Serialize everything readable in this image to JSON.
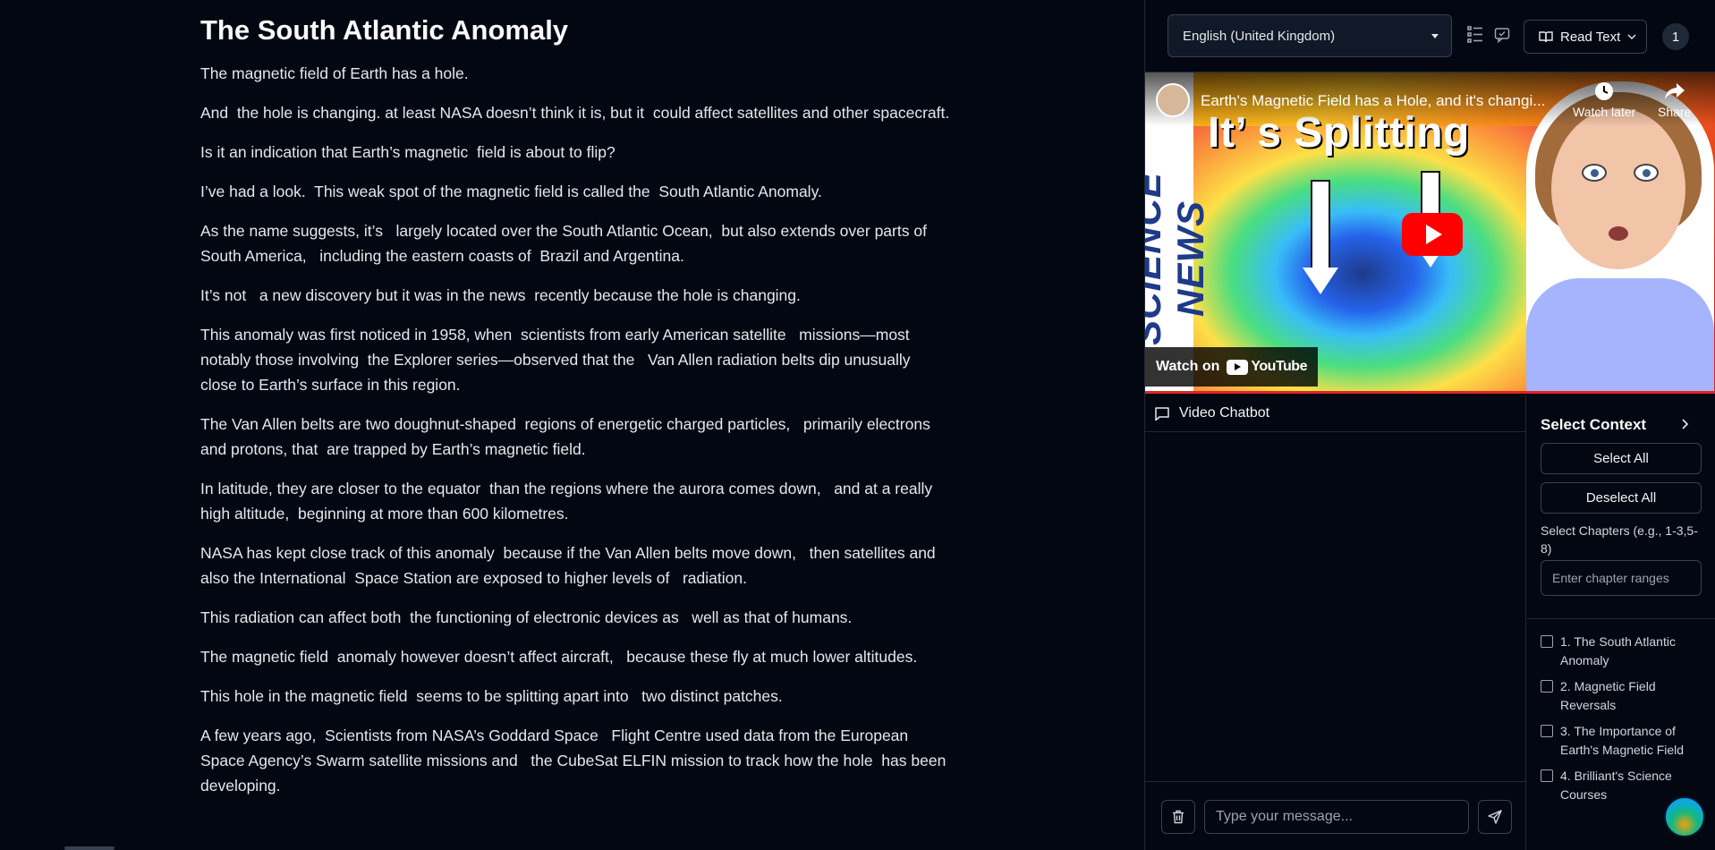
{
  "article": {
    "title": "The South Atlantic Anomaly",
    "paragraphs": [
      "The magnetic field of Earth has a hole.",
      "And  the hole is changing. at least NASA doesn’t think it is, but it  could affect satellites and other spacecraft.",
      "Is it an indication that Earth’s magnetic  field is about to flip?",
      "I’ve had a look.  This weak spot of the magnetic field is called the  South Atlantic Anomaly.",
      "As the name suggests, it’s   largely located over the South Atlantic Ocean,  but also extends over parts of South America,   including the eastern coasts of  Brazil and Argentina.",
      "It’s not   a new discovery but it was in the news  recently because the hole is changing.",
      "This anomaly was first noticed in 1958, when  scientists from early American satellite   missions—most notably those involving  the Explorer series—observed that the   Van Allen radiation belts dip unusually  close to Earth’s surface in this region.",
      "The Van Allen belts are two doughnut-shaped  regions of energetic charged particles,   primarily electrons and protons, that  are trapped by Earth’s magnetic field.",
      "In latitude, they are closer to the equator  than the regions where the aurora comes down,   and at a really high altitude,  beginning at more than 600 kilometres.",
      "NASA has kept close track of this anomaly  because if the Van Allen belts move down,   then satellites and also the International  Space Station are exposed to higher levels of   radiation.",
      "This radiation can affect both  the functioning of electronic devices as   well as that of humans.",
      "The magnetic field  anomaly however doesn’t affect aircraft,   because these fly at much lower altitudes.",
      "This hole in the magnetic field  seems to be splitting apart into   two distinct patches.",
      "A few years ago,  Scientists from NASA’s Goddard Space   Flight Centre used data from the European  Space Agency’s Swarm satellite missions and   the CubeSat ELFIN mission to track how the hole  has been developing."
    ]
  },
  "toolbar": {
    "language": "English (United Kingdom)",
    "read_text_label": "Read Text",
    "badge_count": "1"
  },
  "video": {
    "title": "Earth's Magnetic Field has a Hole, and it's changi...",
    "headline": "It’ s Splitting",
    "side_text": "SCIENCE NEWS",
    "watch_later": "Watch later",
    "share": "Share",
    "watch_on": "Watch on",
    "youtube": "YouTube"
  },
  "chatbot": {
    "title": "Video Chatbot",
    "input_placeholder": "Type your message..."
  },
  "context": {
    "title": "Select Context",
    "select_all": "Select All",
    "deselect_all": "Deselect All",
    "chapters_label": "Select Chapters (e.g., 1-3,5-8)",
    "range_placeholder": "Enter chapter ranges",
    "chapters": [
      {
        "label": "1. The South Atlantic Anomaly",
        "checked": false
      },
      {
        "label": "2. Magnetic Field Reversals",
        "checked": false
      },
      {
        "label": "3. The Importance of Earth's Magnetic Field",
        "checked": false
      },
      {
        "label": "4. Brilliant's Science Courses",
        "checked": false
      }
    ]
  },
  "colors": {
    "background": "#030712",
    "border": "#1f2937",
    "youtube_red": "#ff0000"
  }
}
